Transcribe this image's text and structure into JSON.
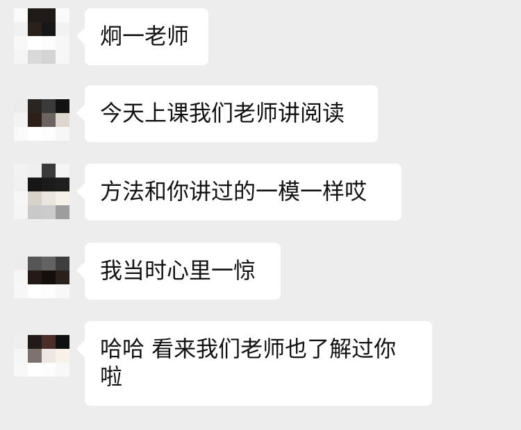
{
  "colors": {
    "background": "#ededed",
    "bubble": "#ffffff",
    "text": "#111111"
  },
  "messages": [
    {
      "text": "炯一老师",
      "avatar": [
        "#fafafa",
        "#1e1a16",
        "#1e1a16",
        "#fafafa",
        "#f0f0f0",
        "#2b211b",
        "#171717",
        "#f2f2f2",
        "#f8f8f8",
        "#ffffff",
        "#fcfcfc",
        "#f7f7f7",
        "#f5f5f5",
        "#d9d9d9",
        "#d4d4d4",
        "#f7f7f7"
      ]
    },
    {
      "text": "今天上课我们老师讲阅读",
      "avatar": [
        "#ededed",
        "#ededed",
        "#ededed",
        "#ededed",
        "#ececec",
        "#2b2521",
        "#3a3a3a",
        "#121212",
        "#f3f3f3",
        "#2c1e18",
        "#6a635f",
        "#dcd6ce",
        "#f9f9f9",
        "#ffffff",
        "#fdfdfd",
        "#f7f7f7"
      ]
    },
    {
      "text": "方法和你讲过的一模一样哎",
      "avatar": [
        "#f2f2f2",
        "#efefef",
        "#3a3a3a",
        "#f5f5f5",
        "#f0f0f0",
        "#161616",
        "#1b1b1b",
        "#1f1f1f",
        "#f6f6f6",
        "#d9d2c8",
        "#eae6df",
        "#f6f1e8",
        "#f5f5f5",
        "#c9c9c9",
        "#cbcbcb",
        "#9d9d9d"
      ]
    },
    {
      "text": "我当时心里一惊",
      "avatar": [
        "#ededed",
        "#ededed",
        "#ededed",
        "#ededed",
        "#ececec",
        "#565656",
        "#636363",
        "#3e3e3e",
        "#f6f6f6",
        "#231a15",
        "#140f0b",
        "#2a211c",
        "#f7f7f7",
        "#ffffff",
        "#fdfdfd",
        "#f8f8f8"
      ]
    },
    {
      "text": "哈哈 看来我们老师也了解过你啦",
      "avatar": [
        "#ededed",
        "#ededed",
        "#ededed",
        "#ededed",
        "#efefef",
        "#211a17",
        "#4a2e27",
        "#0f0f0f",
        "#f6f6f6",
        "#7d736e",
        "#ece7e2",
        "#f8f1ea",
        "#f8f8f8",
        "#ffffff",
        "#fdfdfd",
        "#f8f8f8"
      ]
    }
  ]
}
